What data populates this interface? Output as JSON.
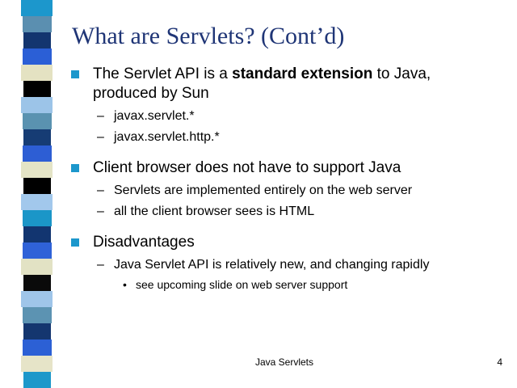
{
  "slide": {
    "title": "What are Servlets? (Cont’d)",
    "bullets": [
      {
        "text_before": "The Servlet API is a ",
        "text_bold": "standard extension",
        "text_after": " to Java, produced by Sun",
        "subs": [
          {
            "marker": "–",
            "text": "javax.servlet.*"
          },
          {
            "marker": "–",
            "text": "javax.servlet.http.*"
          }
        ]
      },
      {
        "text": "Client browser does not have to support Java",
        "subs": [
          {
            "marker": "–",
            "text": "Servlets are implemented entirely on the web server"
          },
          {
            "marker": "–",
            "text": "all the client browser sees is HTML"
          }
        ]
      },
      {
        "text": "Disadvantages",
        "subs": [
          {
            "marker": "–",
            "text": "Java Servlet API is relatively new, and changing rapidly",
            "subs": [
              {
                "marker": "•",
                "text": "see upcoming slide on web server support"
              }
            ]
          }
        ]
      }
    ],
    "footer": "Java Servlets",
    "page_number": "4"
  },
  "theme": {
    "title_color": "#1f3576",
    "bullet_color": "#1c97cc",
    "strip_colors": [
      "#1c97cc",
      "#5b8fb0",
      "#13356f",
      "#2b5fd6",
      "#e4e2c2",
      "#000000",
      "#9cc4e8",
      "#5a92b0",
      "#163c74",
      "#2d5ed4",
      "#e4e4c6",
      "#000000",
      "#a2c8ec",
      "#1b96c8",
      "#123570",
      "#2f62d8",
      "#e2e2c4",
      "#0a0a0a",
      "#9fc5e9",
      "#5c93b2",
      "#14366f",
      "#2c60d5",
      "#e6e4c8",
      "#1d98ca"
    ]
  }
}
